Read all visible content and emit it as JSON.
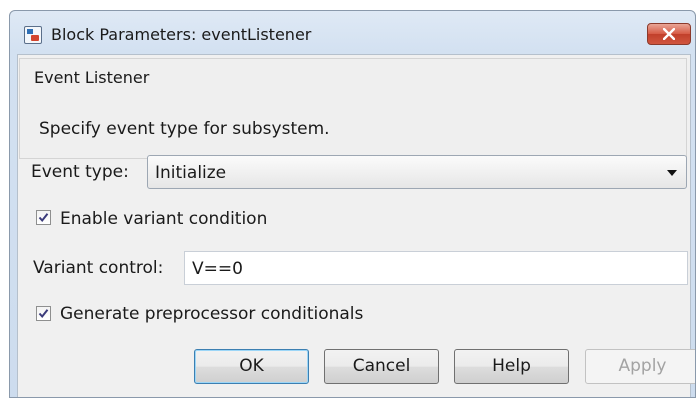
{
  "window": {
    "title": "Block Parameters: eventListener",
    "close_icon": "close-icon"
  },
  "group": {
    "title": "Event Listener",
    "description": "Specify event type for subsystem."
  },
  "event_type": {
    "label": "Event type:",
    "value": "Initialize"
  },
  "enable_variant": {
    "label": "Enable variant condition",
    "checked": true
  },
  "variant_control": {
    "label": "Variant control:",
    "value": "V==0"
  },
  "generate_preprocessor": {
    "label": "Generate preprocessor conditionals",
    "checked": true
  },
  "buttons": {
    "ok": "OK",
    "cancel": "Cancel",
    "help": "Help",
    "apply": "Apply"
  },
  "colors": {
    "titlebar": "#d3e1f1",
    "close_button": "#c1402b",
    "dialog_background": "#f0f0f0",
    "checkmark": "#3a3a7a"
  }
}
